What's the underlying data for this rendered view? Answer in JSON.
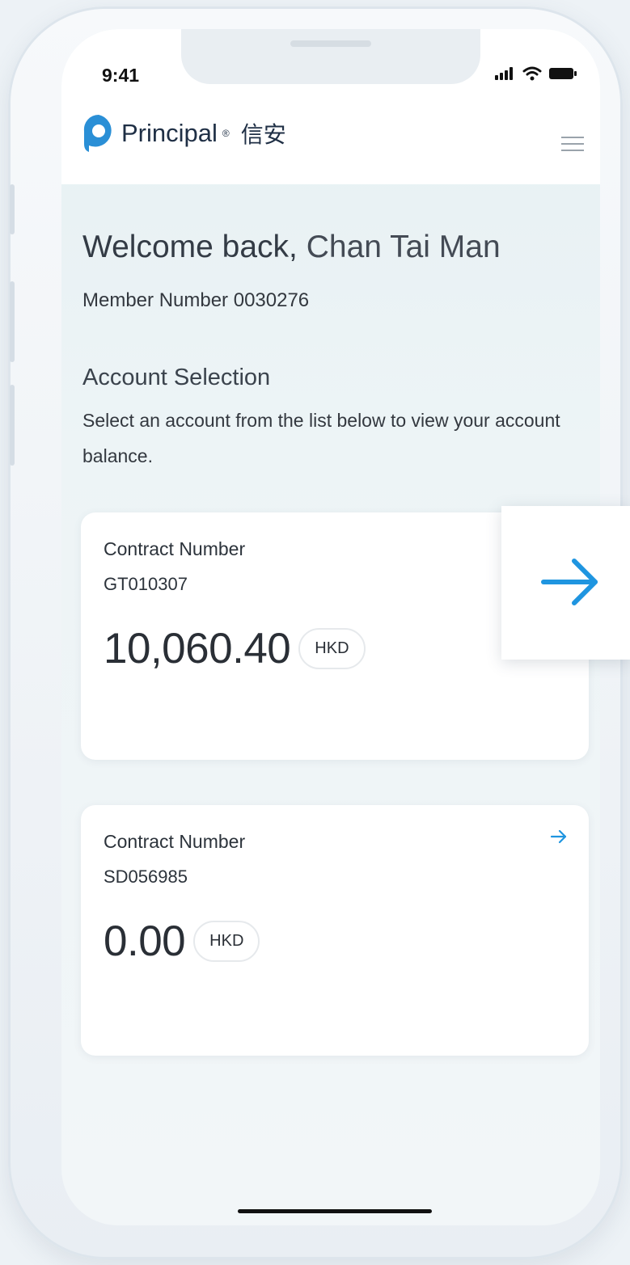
{
  "status_bar": {
    "time": "9:41",
    "icons": [
      "signal-icon",
      "wifi-icon",
      "battery-icon"
    ]
  },
  "header": {
    "brand": "Principal",
    "brand_registered": "®",
    "brand_chinese": "信安",
    "menu_icon": "hamburger-menu-icon"
  },
  "welcome": {
    "greeting": "Welcome back,",
    "name": "Chan Tai Man",
    "member_label": "Member Number 0030276"
  },
  "account_selection": {
    "title": "Account Selection",
    "description": "Select an account from the list below to view your account balance."
  },
  "accounts": [
    {
      "label": "Contract Number",
      "contract": "GT010307",
      "balance": "10,060.40",
      "currency": "HKD"
    },
    {
      "label": "Contract Number",
      "contract": "SD056985",
      "balance": "0.00",
      "currency": "HKD"
    }
  ],
  "colors": {
    "accent_blue": "#1f95e0",
    "logo_blue": "#2a8fd6",
    "text_dark": "#2c333b"
  }
}
